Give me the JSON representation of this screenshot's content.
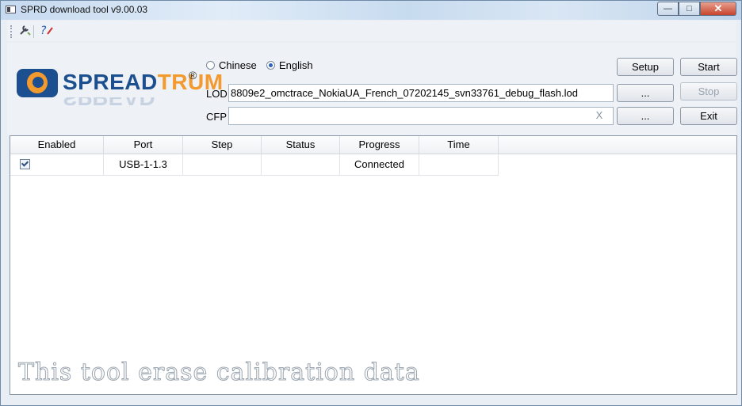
{
  "window": {
    "title": "SPRD download tool v9.00.03"
  },
  "titlebar_buttons": {
    "minimize": "—",
    "maximize": "□",
    "close": "✕"
  },
  "toolbar": {
    "settings_icon": "settings-wrench-icon",
    "help_icon": "help-icon"
  },
  "logo": {
    "text_a": "SPREAD",
    "text_b": "TRUM",
    "reg": "®"
  },
  "language": {
    "option1": "Chinese",
    "option2": "English",
    "selected": "English"
  },
  "lod": {
    "label": "LOD",
    "value": "8809e2_omctrace_NokiaUA_French_07202145_svn33761_debug_flash.lod",
    "browse": "..."
  },
  "cfp": {
    "label": "CFP",
    "value": "",
    "clear": "X",
    "browse": "..."
  },
  "buttons": {
    "setup": "Setup",
    "start": "Start",
    "stop": "Stop",
    "exit": "Exit"
  },
  "table": {
    "columns": [
      "Enabled",
      "Port",
      "Step",
      "Status",
      "Progress",
      "Time"
    ],
    "rows": [
      {
        "enabled": true,
        "port": "USB-1-1.3",
        "step": "",
        "status": "",
        "progress": "Connected",
        "time": ""
      }
    ]
  },
  "watermark": "This tool erase calibration data",
  "colors": {
    "logo_blue": "#1c4f8f",
    "logo_orange": "#f29a2e",
    "close_red": "#c6442d"
  }
}
